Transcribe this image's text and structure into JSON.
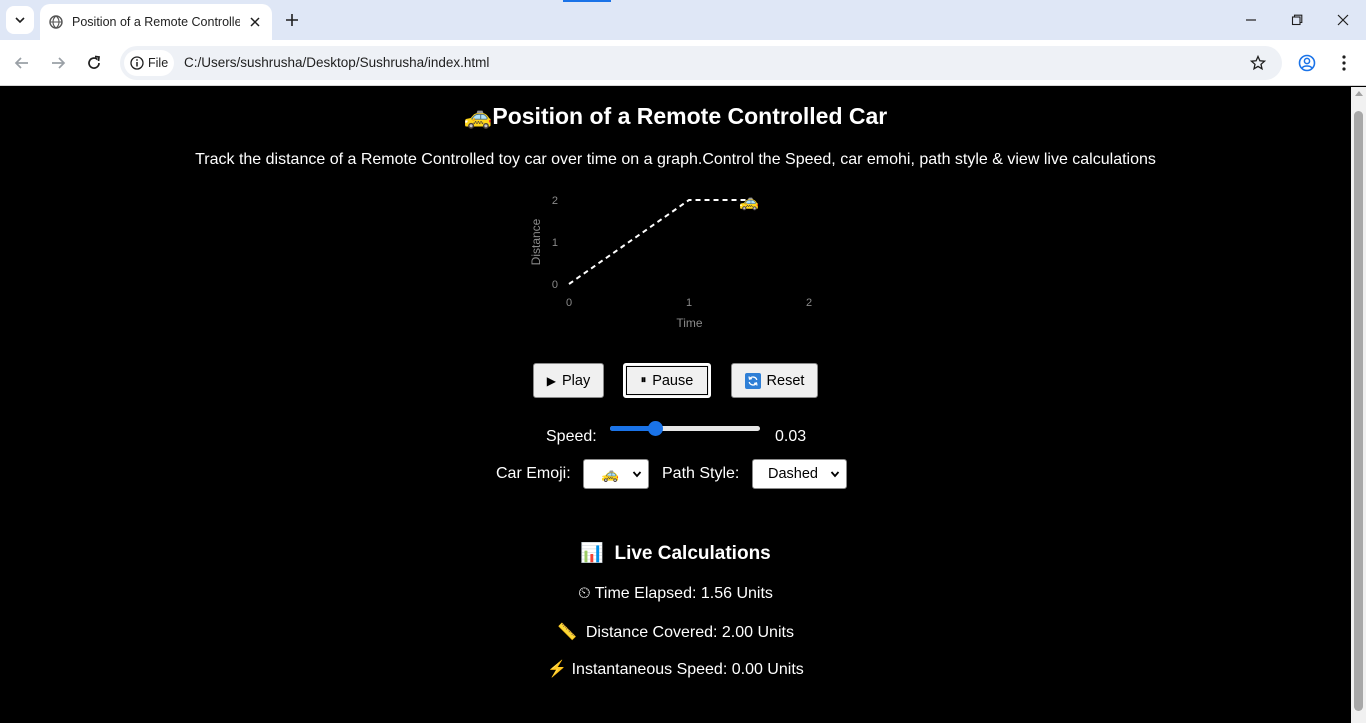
{
  "browser": {
    "tab_title": "Position of a Remote Controlled Car",
    "chip_label": "File",
    "url": "C:/Users/sushrusha/Desktop/Sushrusha/index.html",
    "icons": [
      "tab-search-icon",
      "globe-icon",
      "close-icon",
      "plus-icon",
      "minimize-icon",
      "restore-icon",
      "close-window-icon",
      "back-arrow-icon",
      "forward-arrow-icon",
      "reload-icon",
      "info-icon",
      "star-icon",
      "profile-icon",
      "menu-dots-icon"
    ],
    "accent": "#1a73e8"
  },
  "page": {
    "title_emoji": "🚕",
    "title": "Position of a Remote Controlled Car",
    "subtitle": "Track the distance of a Remote Controlled toy car over time on a graph.Control the Speed, car emohi, path style & view live calculations"
  },
  "chart_data": {
    "type": "line",
    "xlabel": "Time",
    "ylabel": "Distance",
    "x_ticks": [
      "0",
      "1",
      "2"
    ],
    "y_ticks": [
      "0",
      "1",
      "2"
    ],
    "xlim": [
      0,
      2
    ],
    "ylim": [
      0,
      2
    ],
    "grid": false,
    "line_style": "dashed",
    "line_color": "#ffffff",
    "series": [
      {
        "x": [
          0,
          1,
          1.5
        ],
        "y": [
          0,
          2,
          2
        ]
      }
    ],
    "car_marker": {
      "emoji": "🚕",
      "x": 1.5,
      "y": 2
    }
  },
  "controls": {
    "play_label": "Play",
    "pause_label": "Pause",
    "reset_label": "Reset",
    "speed_label": "Speed:",
    "speed_value": "0.03",
    "speed_fraction": 0.3,
    "car_emoji_label": "Car Emoji:",
    "car_emoji_selected": "🚕",
    "path_style_label": "Path Style:",
    "path_style_selected": "Dashed"
  },
  "calculations": {
    "heading_icon": "📊",
    "heading": "Live Calculations",
    "time_icon": "⏲",
    "time": "Time Elapsed: 1.56 Units",
    "distance_icon": "📏",
    "distance": "Distance Covered: 2.00 Units",
    "speed_icon": "⚡",
    "speed": "Instantaneous Speed: 0.00 Units"
  }
}
